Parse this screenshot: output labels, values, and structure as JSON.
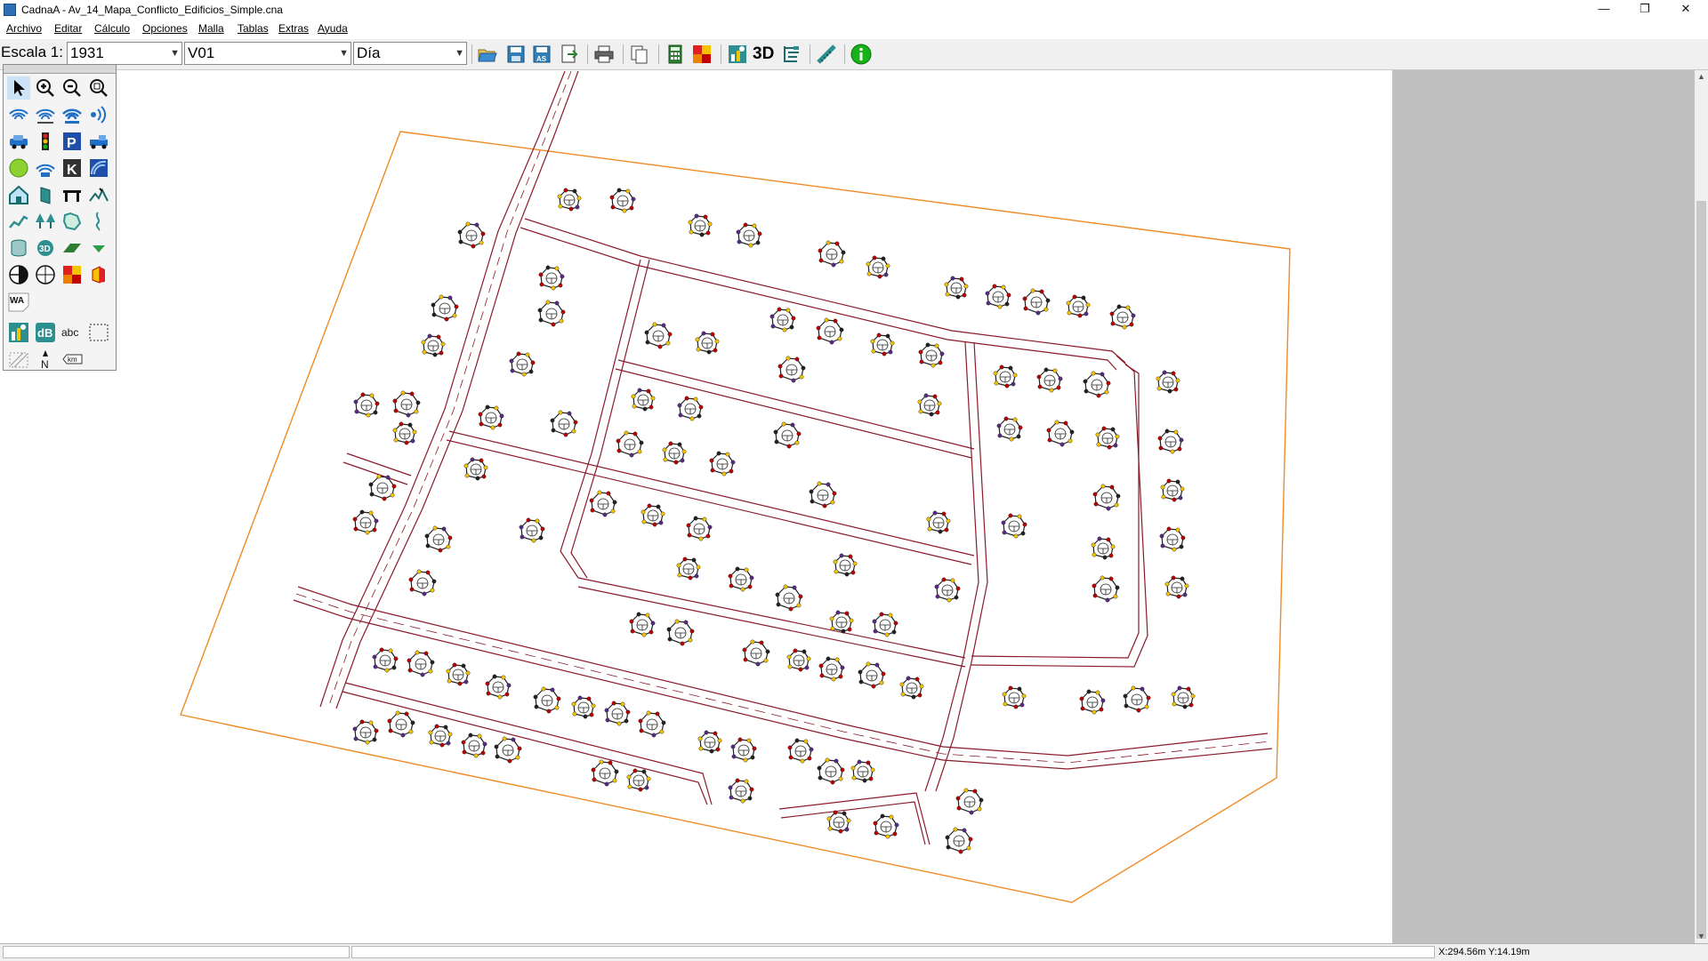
{
  "window": {
    "title": "CadnaA - Av_14_Mapa_Conflicto_Edificios_Simple.cna",
    "minimize": "—",
    "restore": "❐",
    "close": "✕"
  },
  "menu": [
    "Archivo",
    "Editar",
    "Cálculo",
    "Opciones",
    "Malla",
    "Tablas",
    "Extras",
    "Ayuda"
  ],
  "toolbar": {
    "scale_label": "Escala 1:",
    "scale_value": "1931",
    "variant_value": "V01",
    "period_value": "Día",
    "label_3d": "3D",
    "icons": [
      "open-icon",
      "save-icon",
      "save-as-icon",
      "export-icon",
      "print-icon",
      "copy-icon",
      "calculator-icon",
      "grid-map-icon",
      "object-tree-icon",
      "3d-view-icon",
      "table-icon",
      "ruler-icon",
      "info-icon"
    ]
  },
  "palette": {
    "labels": {
      "wa": "WA",
      "db": "dB",
      "abc": "abc",
      "north": "N",
      "km": "km"
    }
  },
  "status": {
    "coordinates": "X:294.56m Y:14.19m"
  },
  "colors": {
    "road": "#8b1a2b",
    "boundary": "#f08a24",
    "building": "#222222",
    "panel_gray": "#c0c0c0"
  }
}
